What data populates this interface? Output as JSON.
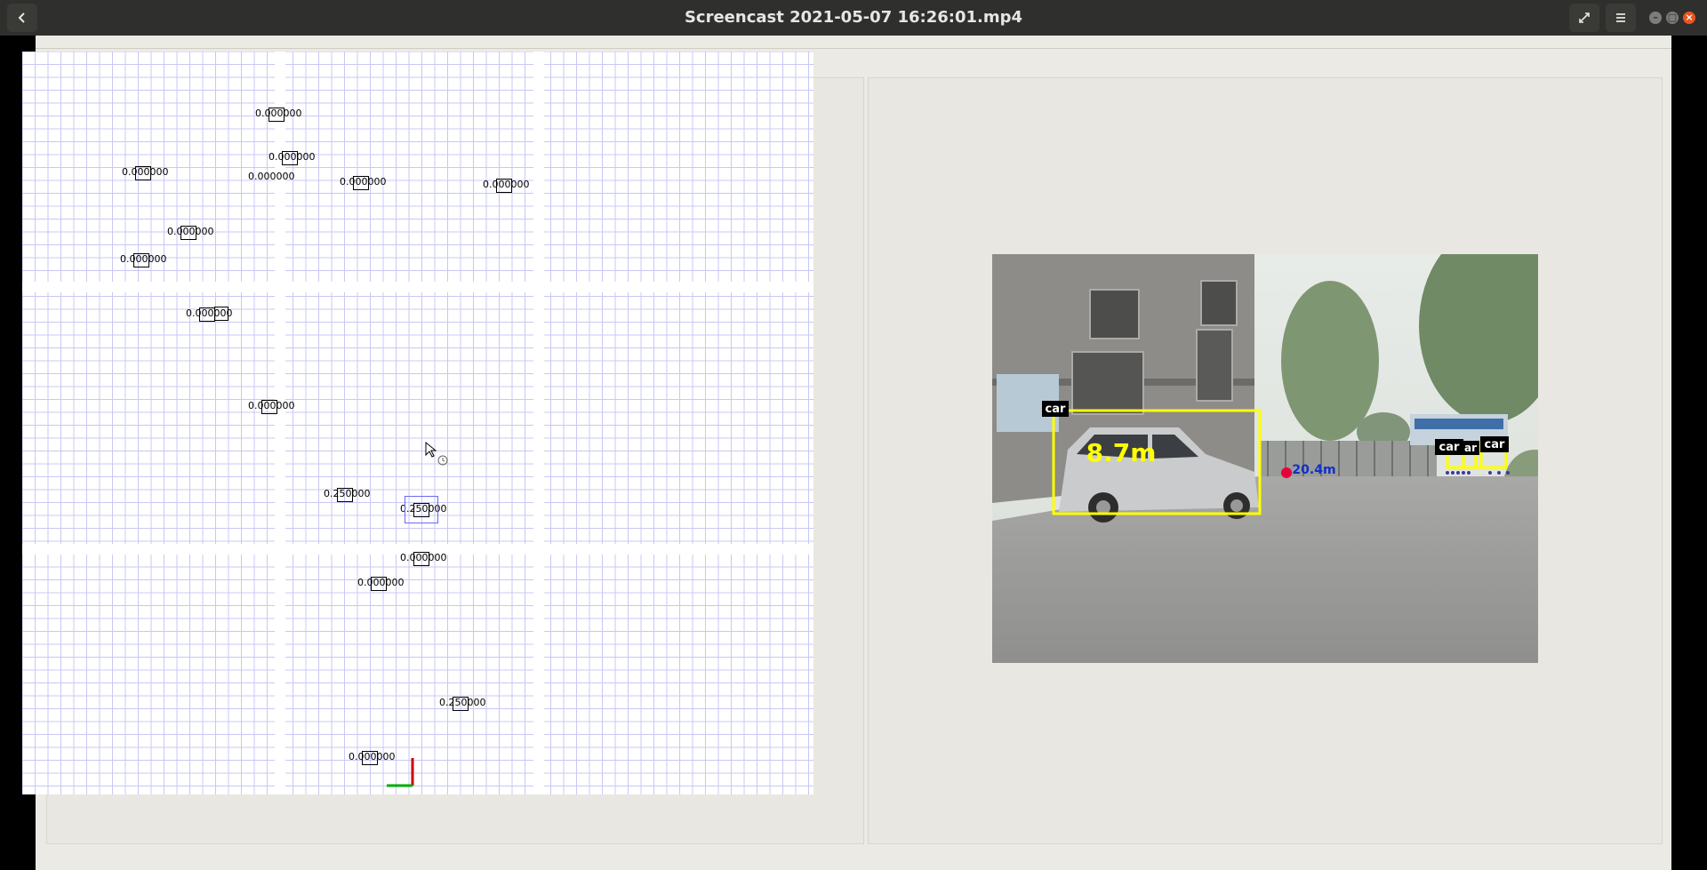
{
  "window": {
    "title": "Screencast 2021-05-07 16:26:01.mp4"
  },
  "toolbar": {
    "back_icon": "chevron-left-icon",
    "fullscreen_icon": "fullscreen-icon",
    "menu_icon": "hamburger-menu-icon",
    "minimize_icon": "minimize-icon",
    "maximize_icon": "maximize-icon",
    "close_icon": "close-icon"
  },
  "map": {
    "markers": [
      {
        "label": "0.000000"
      },
      {
        "label": "0.000000"
      },
      {
        "label": "0.000000"
      },
      {
        "label": "0.000000"
      },
      {
        "label": "0.000000"
      },
      {
        "label": "0.000000"
      },
      {
        "label": "0.000000"
      },
      {
        "label": "0.000000"
      },
      {
        "label": "0.000000"
      },
      {
        "label": "0.000000"
      },
      {
        "label": "0.250000"
      },
      {
        "label": "0.250000"
      },
      {
        "label": "0.000000"
      },
      {
        "label": "0.000000"
      },
      {
        "label": "0.250000"
      },
      {
        "label": "0.000000"
      }
    ]
  },
  "camera": {
    "detections": [
      {
        "label": "car",
        "distance": "8.7m"
      },
      {
        "label": "car"
      },
      {
        "label": "ar"
      },
      {
        "label": "car"
      }
    ],
    "far_distance": "20.4m"
  },
  "colors": {
    "titlebar": "#2f2f2d",
    "background": "#eceae4",
    "grid": "#c8c8f5",
    "bbox": "#ffff00",
    "axis_x": "#cc0000",
    "axis_y": "#00aa00"
  }
}
